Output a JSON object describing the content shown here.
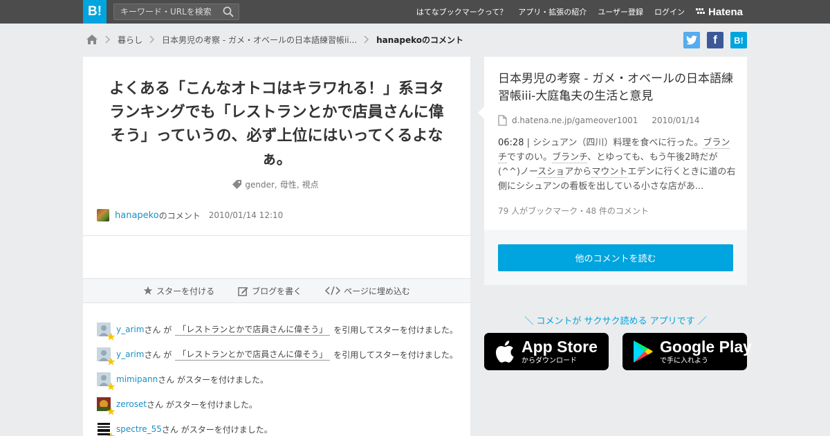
{
  "header": {
    "logo_text": "B!",
    "search_placeholder": "キーワード・URLを検索",
    "nav": [
      "はてなブックマークって？",
      "アプリ・拡張の紹介",
      "ユーザー登録",
      "ログイン"
    ],
    "brand": "Hatena"
  },
  "breadcrumb": {
    "items": [
      "暮らし",
      "日本男児の考察 - ガメ・オベールの日本語練習帳ii..."
    ],
    "current": "hanapekoのコメント"
  },
  "share": {
    "facebook_label": "f",
    "hatena_label": "B!"
  },
  "comment": {
    "text": "よくある「こんなオトコはキラワれる！」系ヨタランキングでも「レストランとかで店員さんに偉そう」っていうの、必ず上位にはいってくるよなぁ。",
    "tags": [
      "gender,",
      "母性,",
      "視点"
    ],
    "user": "hanapeko",
    "user_suffix": "のコメント",
    "datetime": "2010/01/14 12:10"
  },
  "actions": {
    "star": "スターを付ける",
    "blog": "ブログを書く",
    "embed": "ページに埋め込む"
  },
  "stars": [
    {
      "user": "y_arim",
      "mid": "さん が",
      "quote": "「レストランとかで店員さんに偉そう」",
      "after": "を引用してスターを付けました。"
    },
    {
      "user": "y_arim",
      "mid": "さん が",
      "quote": "「レストランとかで店員さんに偉そう」",
      "after": "を引用してスターを付けました。"
    },
    {
      "user": "mimipann",
      "mid": "さん がスターを付けました。",
      "quote": "",
      "after": ""
    },
    {
      "user": "zeroset",
      "mid": "さん がスターを付けました。",
      "quote": "",
      "after": ""
    },
    {
      "user": "spectre_55",
      "mid": "さん がスターを付けました。",
      "quote": "",
      "after": ""
    }
  ],
  "entry": {
    "title": "日本男児の考察 - ガメ・オベールの日本語練習帳iii-大庭亀夫の生活と意見",
    "domain": "d.hatena.ne.jp/gameover1001",
    "date": "2010/01/14",
    "summary_time": "06:28",
    "summary_parts": [
      " | シシュアン（四川）料理を食べに行った。",
      "ブランチ",
      "ですのい。",
      "ブランチ",
      "、とゆっても、もう午後2時だが(^^)ノー",
      "スショ",
      "アから",
      "マウント",
      "エデンに行くときに道の右側にシシュアンの看板を出している小さな店があ..."
    ],
    "stats": "79 人がブックマーク・48 件のコメント",
    "more_button": "他のコメントを読む"
  },
  "app_promo": {
    "text": "＼ コメントが サクサク読める アプリです ／",
    "app_store_big": "App Store",
    "app_store_small": "からダウンロード",
    "google_play_big": "Google Play",
    "google_play_small": "で手に入れよう"
  },
  "colors": {
    "brand_blue": "#00a4de",
    "topbar": "#4c4c4c",
    "link": "#1a8ec4",
    "star": "#f5c600"
  }
}
